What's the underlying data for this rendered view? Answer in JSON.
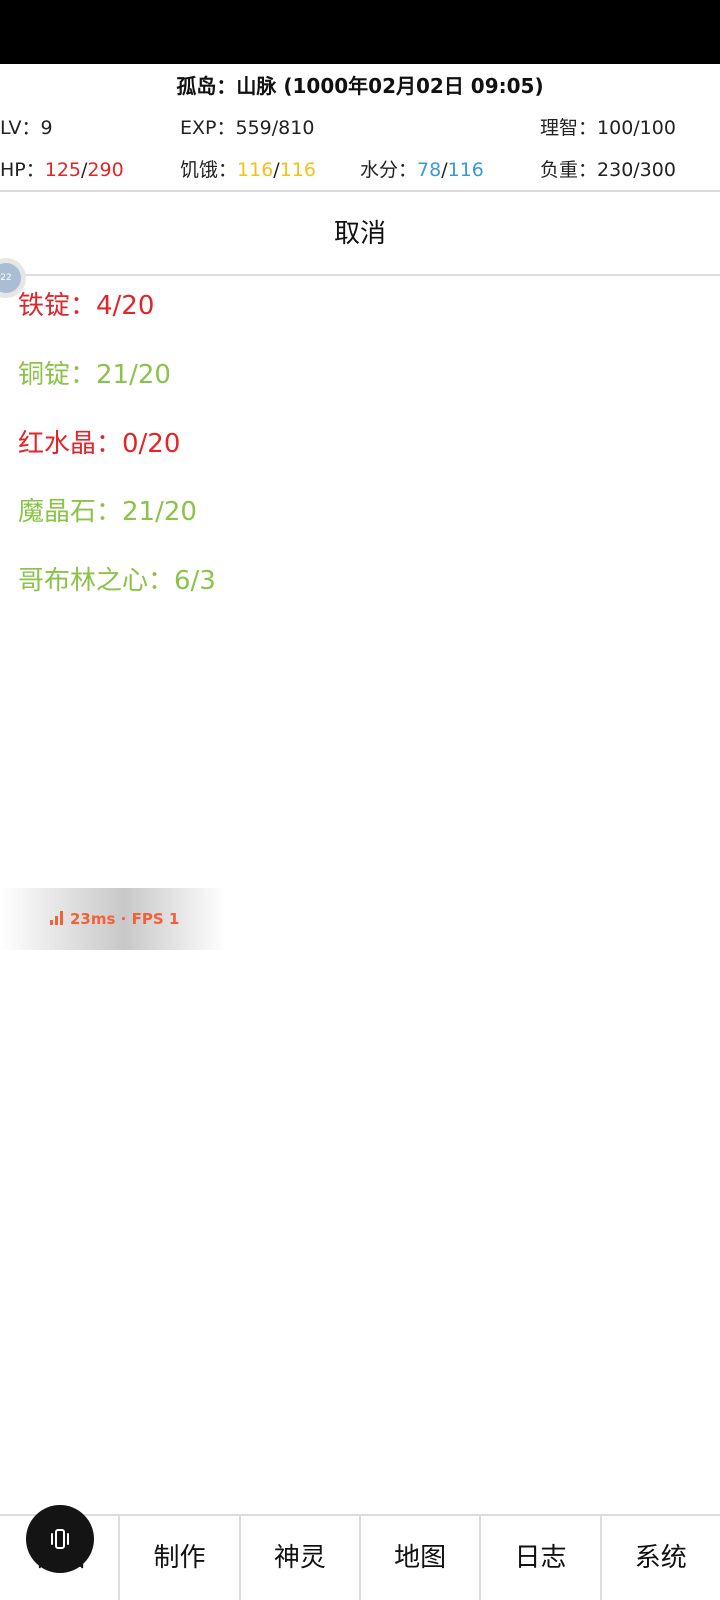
{
  "header": {
    "title": "孤岛：山脉 (1000年02月02日 09:05)",
    "lv": {
      "label": "LV：",
      "value": "9"
    },
    "exp": {
      "label": "EXP：",
      "value": "559/810"
    },
    "sanity": {
      "label": "理智：",
      "value": "100/100"
    },
    "hp": {
      "label": "HP：",
      "current": "125",
      "max": "290"
    },
    "hunger": {
      "label": "饥饿：",
      "current": "116",
      "max": "116"
    },
    "water": {
      "label": "水分：",
      "current": "78",
      "max": "116"
    },
    "load": {
      "label": "负重：",
      "value": "230/300"
    }
  },
  "cancel_label": "取消",
  "float_ball_text": "22",
  "materials": [
    {
      "text": "铁锭：4/20",
      "status": "insufficient"
    },
    {
      "text": "铜锭：21/20",
      "status": "sufficient"
    },
    {
      "text": "红水晶：0/20",
      "status": "insufficient"
    },
    {
      "text": "魔晶石：21/20",
      "status": "sufficient"
    },
    {
      "text": "哥布林之心：6/3",
      "status": "sufficient"
    }
  ],
  "fps_overlay": {
    "text": "23ms · FPS 1"
  },
  "bottom_nav": {
    "tabs": [
      {
        "label": "物品"
      },
      {
        "label": "制作"
      },
      {
        "label": "神灵"
      },
      {
        "label": "地图"
      },
      {
        "label": "日志"
      },
      {
        "label": "系统"
      }
    ]
  },
  "colors": {
    "insufficient": "#e0262a",
    "sufficient": "#8bc34a",
    "hunger": "#f2c21b",
    "water": "#3a9ad9",
    "fps": "#f0623a"
  }
}
